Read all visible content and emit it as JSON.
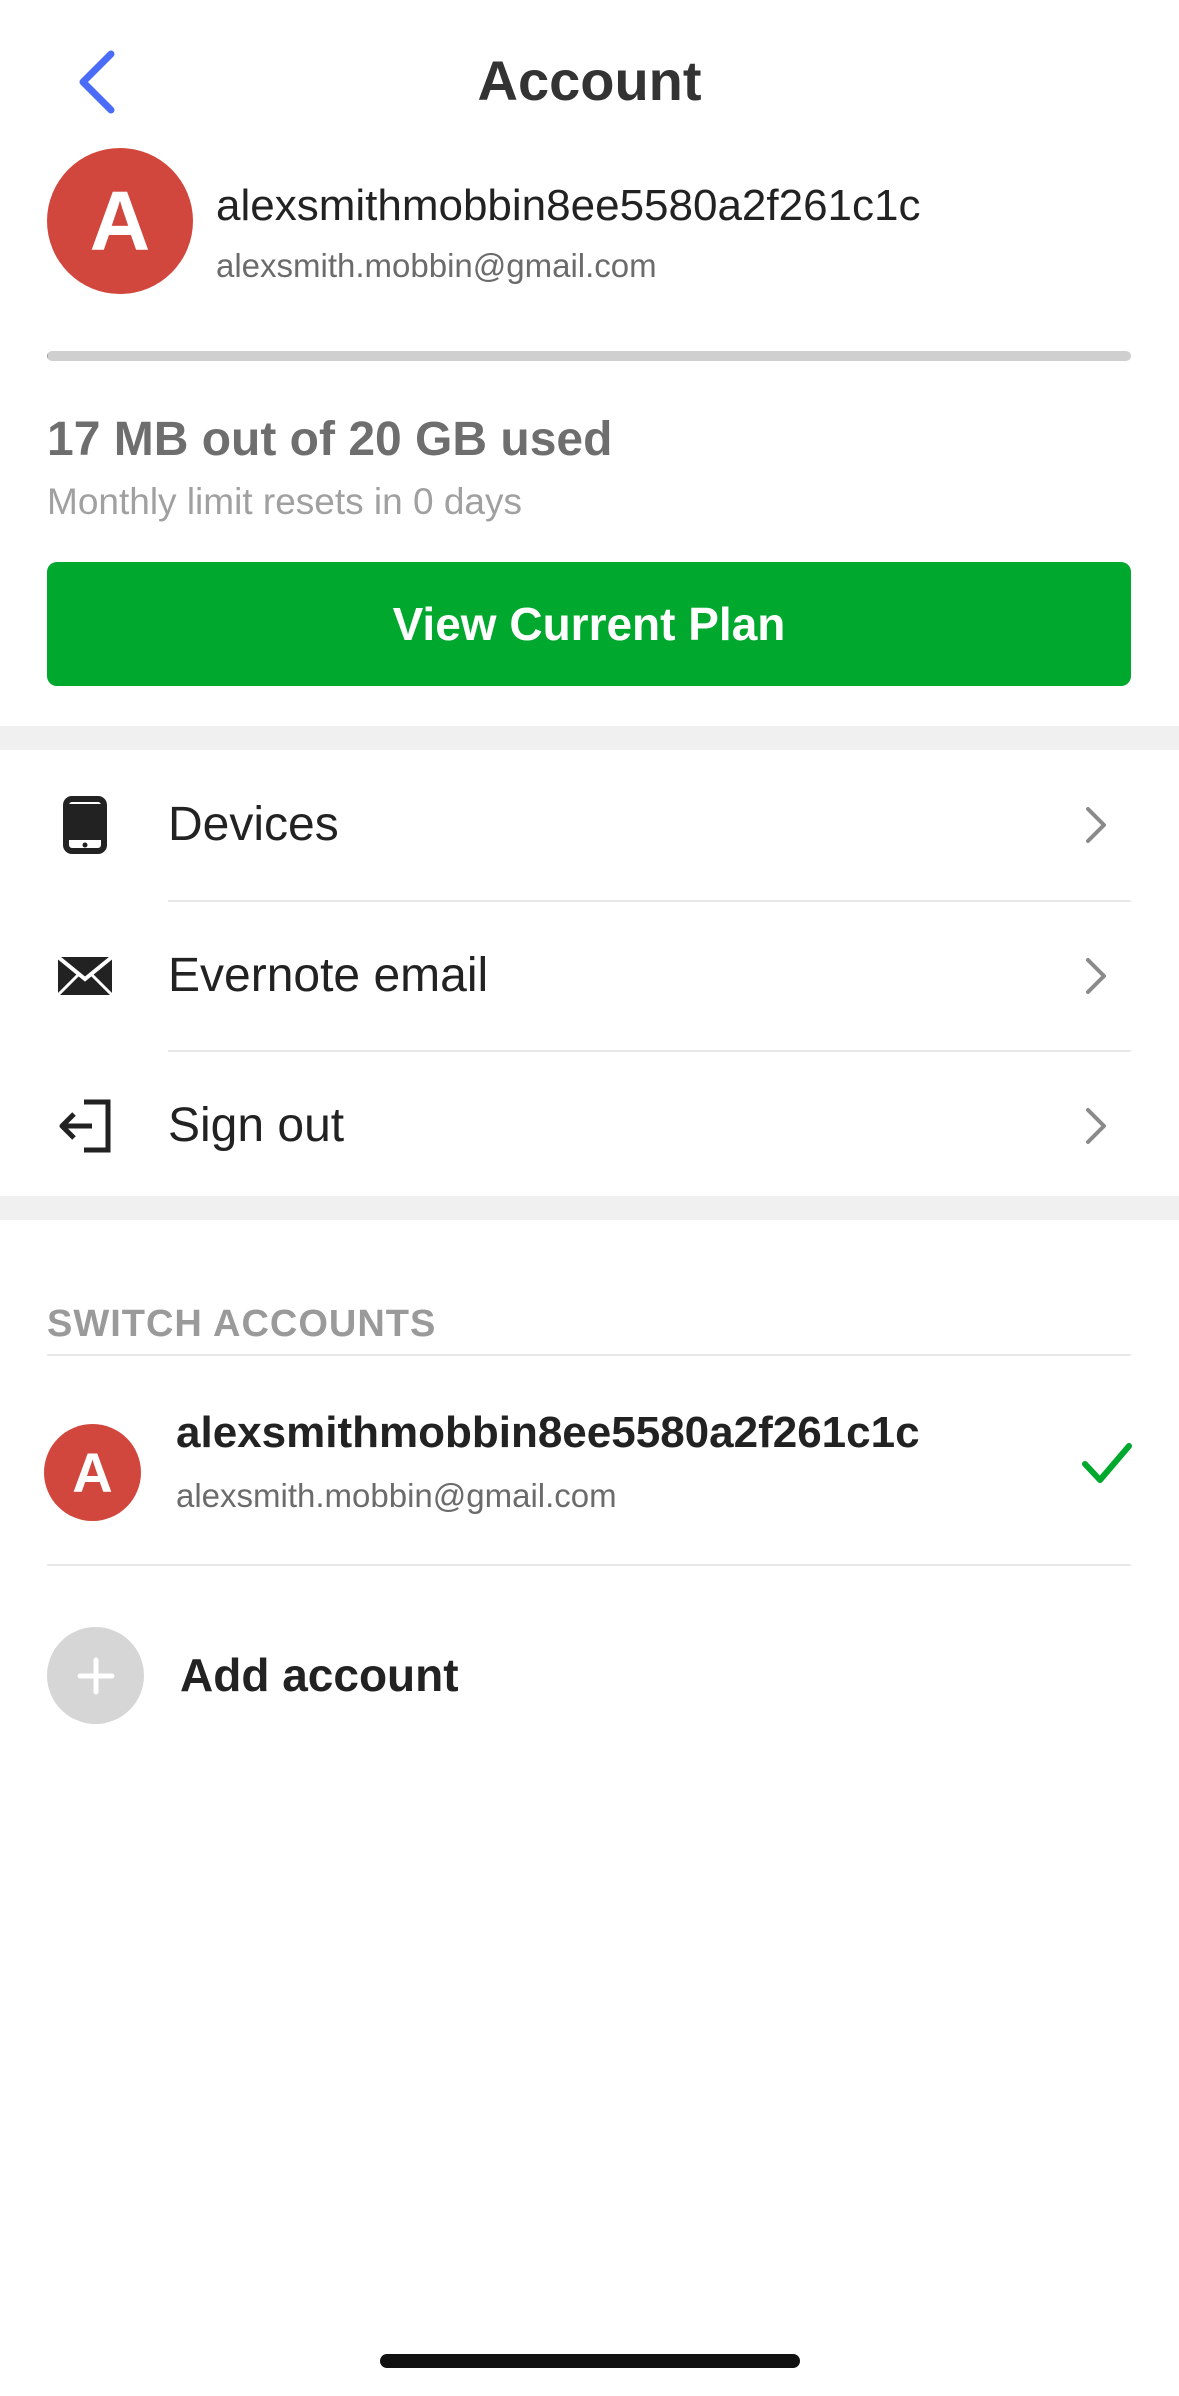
{
  "header": {
    "title": "Account",
    "back_icon": "chevron-left-icon"
  },
  "profile": {
    "avatar_letter": "A",
    "username": "alexsmithmobbin8ee5580a2f261c1c",
    "email": "alexsmith.mobbin@gmail.com"
  },
  "usage": {
    "title": "17 MB out of 20 GB used",
    "subtitle": "Monthly limit resets in 0 days",
    "used_fraction": 0.00083
  },
  "plan_button": {
    "label": "View Current Plan"
  },
  "menu": {
    "items": [
      {
        "label": "Devices",
        "icon": "device-icon"
      },
      {
        "label": "Evernote email",
        "icon": "mail-icon"
      },
      {
        "label": "Sign out",
        "icon": "sign-out-icon"
      }
    ]
  },
  "switch_accounts": {
    "section_label": "SWITCH ACCOUNTS",
    "accounts": [
      {
        "avatar_letter": "A",
        "username": "alexsmithmobbin8ee5580a2f261c1c",
        "email": "alexsmith.mobbin@gmail.com",
        "selected": true
      }
    ],
    "add_label": "Add account"
  },
  "colors": {
    "accent_blue": "#4a6cf7",
    "brand_green": "#00a82d",
    "avatar_red": "#d2473d"
  }
}
